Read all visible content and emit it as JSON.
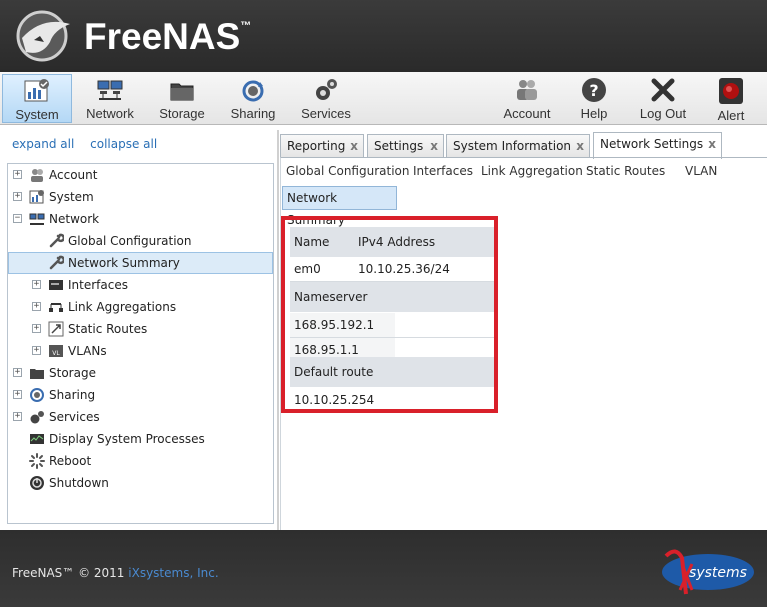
{
  "brand": {
    "name": "FreeNAS",
    "tm": "™"
  },
  "toolbar": {
    "system": "System",
    "network": "Network",
    "storage": "Storage",
    "sharing": "Sharing",
    "services": "Services",
    "account": "Account",
    "help": "Help",
    "logout": "Log Out",
    "alert": "Alert"
  },
  "tree_controls": {
    "expand": "expand all",
    "collapse": "collapse all"
  },
  "tree": {
    "account": "Account",
    "system": "System",
    "network": "Network",
    "global_configuration": "Global Configuration",
    "network_summary": "Network Summary",
    "interfaces": "Interfaces",
    "link_aggregations": "Link Aggregations",
    "static_routes": "Static Routes",
    "vlans": "VLANs",
    "storage": "Storage",
    "sharing": "Sharing",
    "services": "Services",
    "display_processes": "Display System Processes",
    "reboot": "Reboot",
    "shutdown": "Shutdown"
  },
  "tabs": {
    "reporting": "Reporting",
    "settings": "Settings",
    "system_information": "System Information",
    "network_settings": "Network Settings",
    "close": "x"
  },
  "subnav": {
    "global_configuration": "Global Configuration",
    "interfaces": "Interfaces",
    "link_aggregation": "Link Aggregation",
    "static_routes": "Static Routes",
    "vlan": "VLAN"
  },
  "subtab": "Network Summary",
  "summary": {
    "col_name": "Name",
    "col_ipv4": "IPv4 Address",
    "iface_name": "em0",
    "iface_ip": "10.10.25.36/24",
    "nameserver_header": "Nameserver",
    "nameservers": [
      "168.95.192.1",
      "168.95.1.1"
    ],
    "default_route_header": "Default route",
    "default_route": "10.10.25.254"
  },
  "footer": {
    "copyright": "FreeNAS™ © 2011",
    "company": "iXsystems, Inc.",
    "logo_text": "systems"
  },
  "colors": {
    "highlight_border": "#d9202a",
    "link": "#2a6fb5",
    "selected_bg": "#dcebf8"
  }
}
